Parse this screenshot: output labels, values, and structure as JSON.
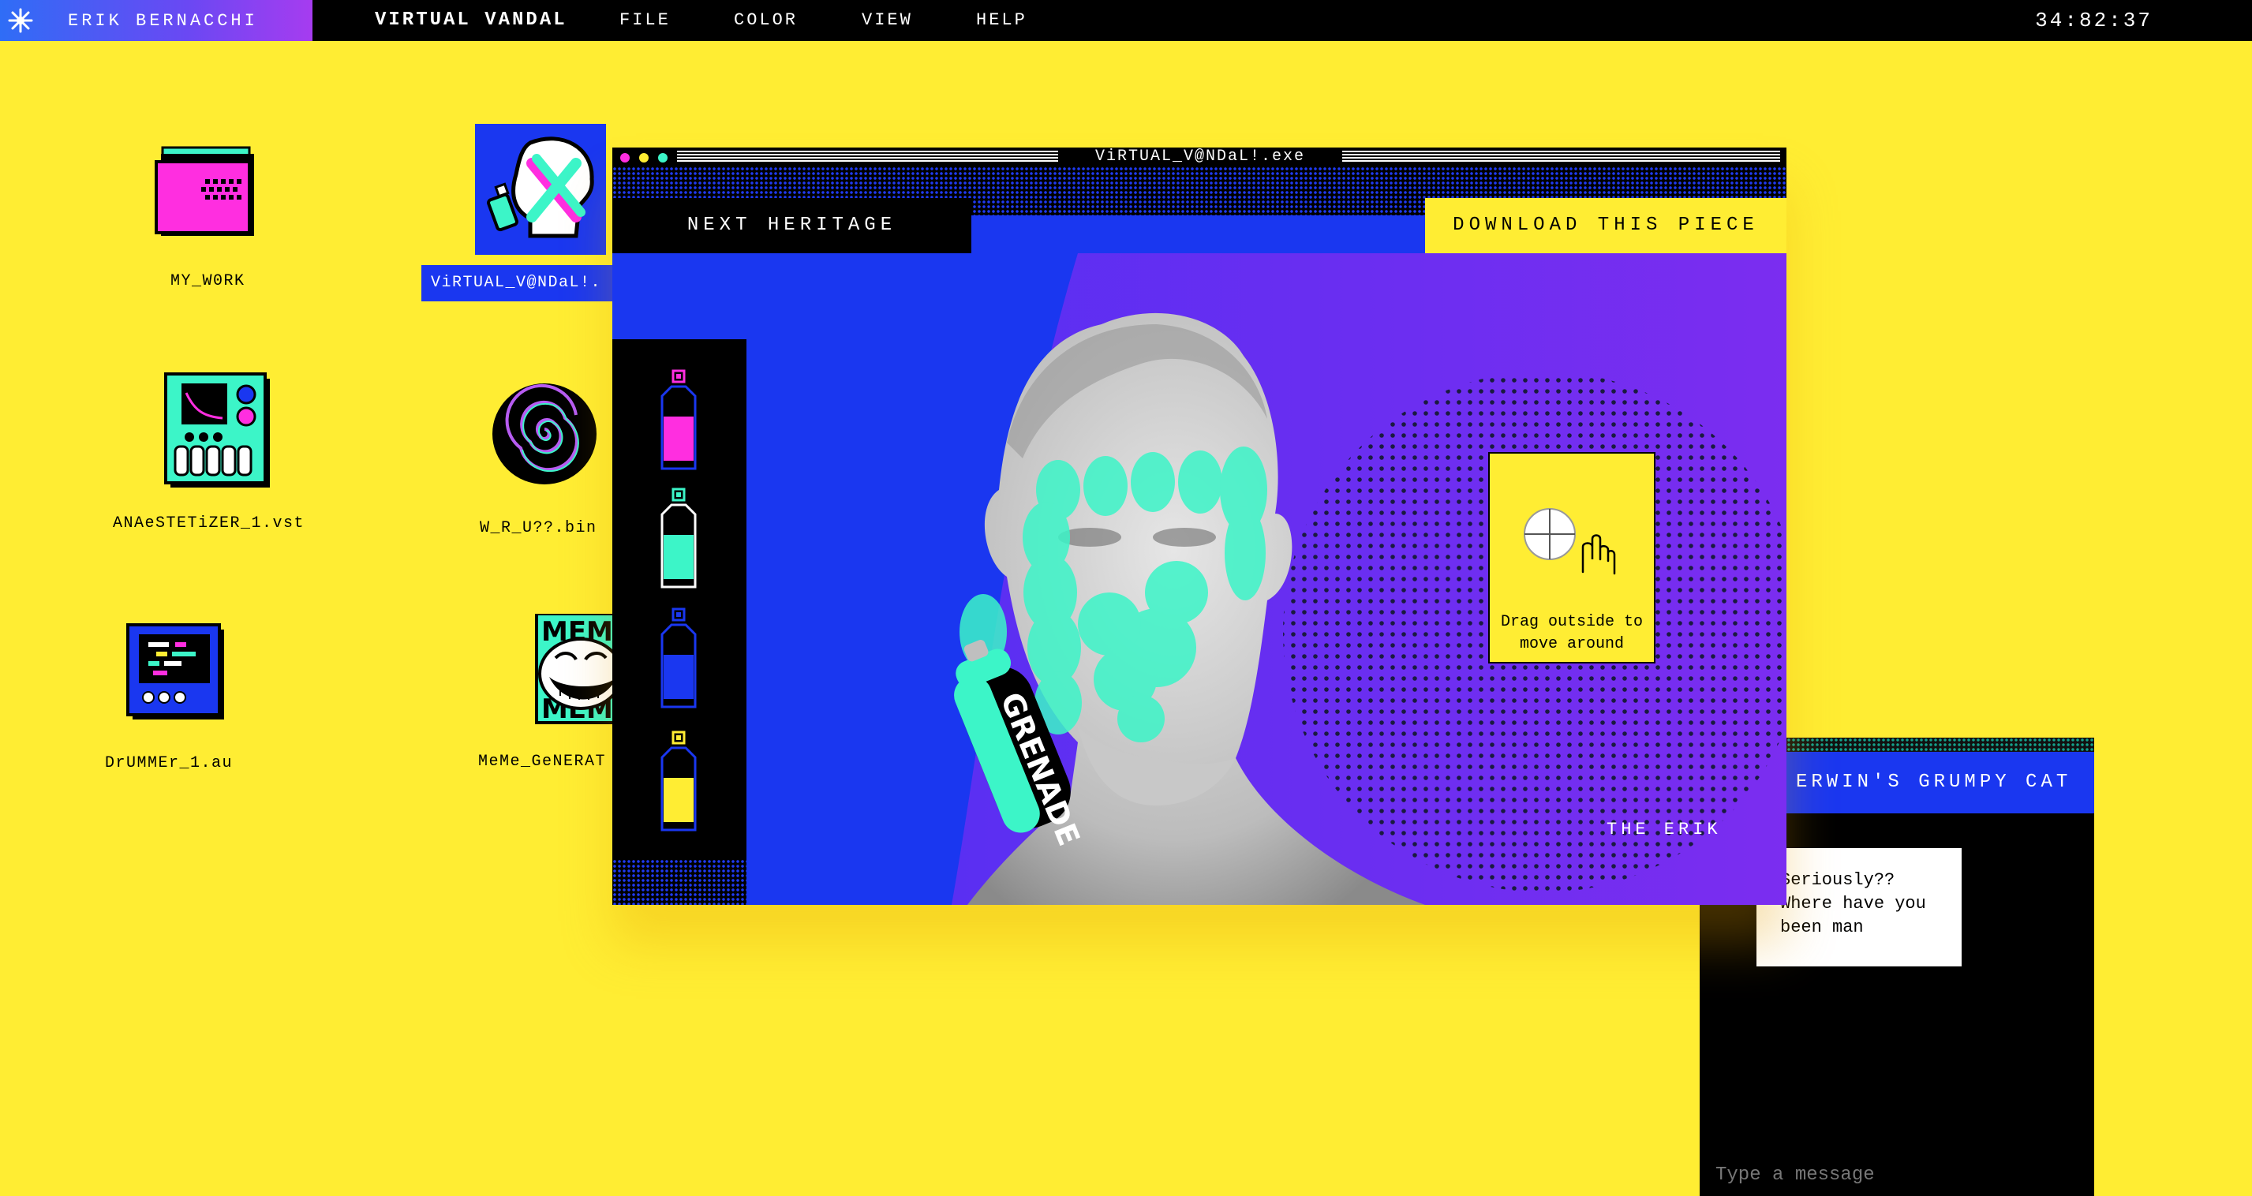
{
  "menubar": {
    "user_name": "ERIK BERNACCHI",
    "app_name": "VIRTUAL VANDAL",
    "menus": [
      "FILE",
      "COLOR",
      "VIEW",
      "HELP"
    ],
    "clock": "34:82:37"
  },
  "desktop": {
    "icons": [
      {
        "label": "MY_W0RK",
        "icon": "pink-folder-icon"
      },
      {
        "label": "ViRTUAL_V@NDaL!.",
        "icon": "spray-head-icon",
        "selected": true
      },
      {
        "label": "ANAeSTETiZER_1.vst",
        "icon": "synth-plugin-icon"
      },
      {
        "label": "W_R_U??.bin",
        "icon": "spiral-icon"
      },
      {
        "label": "DrUMMEr_1.au",
        "icon": "drum-machine-icon"
      },
      {
        "label": "MeMe_GeNERAT",
        "icon": "trollface-meme-icon"
      }
    ]
  },
  "window": {
    "title": "ViRTUAL_V@NDaL!.exe",
    "next_button": "NEXT HERITAGE",
    "download_button": "DOWNLOAD THIS PIECE",
    "spray_cans": [
      {
        "color": "#ff2ee0",
        "name": "magenta"
      },
      {
        "color": "#3cf5c8",
        "name": "teal"
      },
      {
        "color": "#1a37f0",
        "name": "blue"
      },
      {
        "color": "#ffed33",
        "name": "yellow"
      }
    ],
    "selected_can": "teal",
    "can_label": "GRENADE",
    "help_text_line1": "Drag outside to",
    "help_text_line2": "move around",
    "signature": "THE ERIK"
  },
  "chat": {
    "title": "ERWIN'S GRUMPY CAT",
    "message_line1": "Seriously??",
    "message_line2": "Where have you",
    "message_line3": "been man",
    "input_placeholder": "Type a message"
  },
  "colors": {
    "background": "#ffed33",
    "accent_blue": "#1a37f0",
    "magenta": "#ff2ee0",
    "teal": "#3cf5c8",
    "purple": "#7a2df0"
  }
}
